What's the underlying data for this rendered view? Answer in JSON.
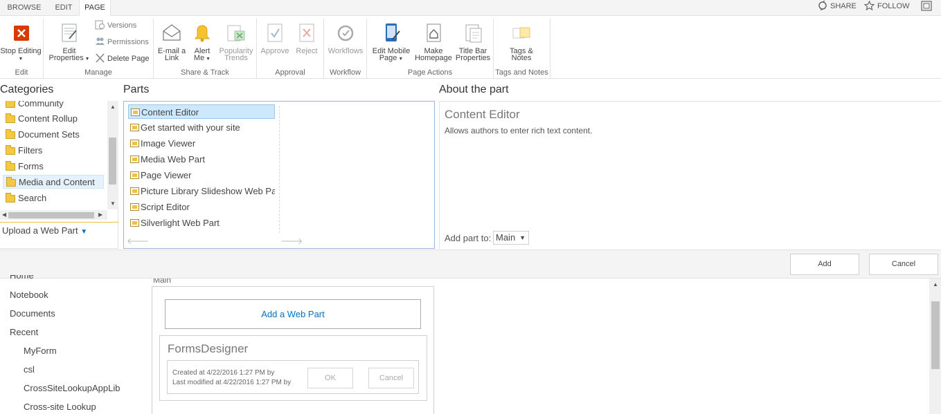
{
  "tabs": [
    {
      "label": "BROWSE"
    },
    {
      "label": "EDIT"
    },
    {
      "label": "PAGE"
    }
  ],
  "top_actions": {
    "share": "SHARE",
    "follow": "FOLLOW"
  },
  "ribbon": {
    "edit_group": {
      "stop_editing": "Stop Editing",
      "label": "Edit"
    },
    "manage": {
      "edit_properties_1": "Edit",
      "edit_properties_2": "Properties",
      "versions": "Versions",
      "permissions": "Permissions",
      "delete_page": "Delete Page",
      "label": "Manage"
    },
    "share_track": {
      "email_1": "E-mail a",
      "email_2": "Link",
      "alert_1": "Alert",
      "alert_2": "Me",
      "trends_1": "Popularity",
      "trends_2": "Trends",
      "label": "Share & Track"
    },
    "approval": {
      "approve": "Approve",
      "reject": "Reject",
      "label": "Approval"
    },
    "workflow": {
      "workflows": "Workflows",
      "label": "Workflow"
    },
    "page_actions": {
      "mobile_1": "Edit Mobile",
      "mobile_2": "Page",
      "homepage_1": "Make",
      "homepage_2": "Homepage",
      "titlebar_1": "Title Bar",
      "titlebar_2": "Properties",
      "label": "Page Actions"
    },
    "tags_notes": {
      "tags_1": "Tags &",
      "tags_2": "Notes",
      "label": "Tags and Notes"
    }
  },
  "categories": {
    "heading": "Categories",
    "items": [
      "Community",
      "Content Rollup",
      "Document Sets",
      "Filters",
      "Forms",
      "Media and Content",
      "Search"
    ],
    "upload": "Upload a Web Part"
  },
  "parts": {
    "heading": "Parts",
    "items": [
      "Content Editor",
      "Get started with your site",
      "Image Viewer",
      "Media Web Part",
      "Page Viewer",
      "Picture Library Slideshow Web Part",
      "Script Editor",
      "Silverlight Web Part"
    ]
  },
  "about": {
    "heading": "About the part",
    "name": "Content Editor",
    "description": "Allows authors to enter rich text content.",
    "add_to_label": "Add part to:",
    "zone": "Main"
  },
  "actions": {
    "add": "Add",
    "cancel": "Cancel"
  },
  "left_nav": [
    "Home",
    "Notebook",
    "Documents",
    "Recent",
    "MyForm",
    "csl",
    "CrossSiteLookupAppLib",
    "Cross-site Lookup"
  ],
  "zone": {
    "label": "Main",
    "add_web_part": "Add a Web Part",
    "webpart": {
      "title": "FormsDesigner",
      "created": "Created at 4/22/2016 1:27 PM by",
      "modified": "Last modified at 4/22/2016 1:27 PM by",
      "ok": "OK",
      "cancel": "Cancel"
    }
  }
}
